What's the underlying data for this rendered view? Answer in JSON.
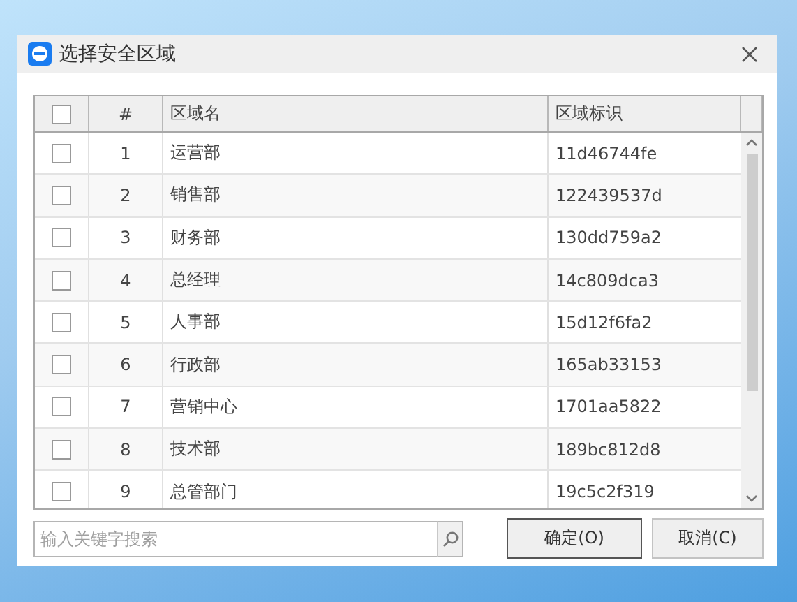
{
  "window": {
    "title": "选择安全区域"
  },
  "table": {
    "select_all": {
      "checked": false
    },
    "columns": [
      "#",
      "区域名",
      "区域标识"
    ],
    "rows": [
      {
        "checked": false,
        "index": "1",
        "name": "运营部",
        "id": "11d46744fe"
      },
      {
        "checked": false,
        "index": "2",
        "name": "销售部",
        "id": "122439537d"
      },
      {
        "checked": false,
        "index": "3",
        "name": "财务部",
        "id": "130dd759a2"
      },
      {
        "checked": false,
        "index": "4",
        "name": "总经理",
        "id": "14c809dca3"
      },
      {
        "checked": false,
        "index": "5",
        "name": "人事部",
        "id": "15d12f6fa2"
      },
      {
        "checked": false,
        "index": "6",
        "name": "行政部",
        "id": "165ab33153"
      },
      {
        "checked": false,
        "index": "7",
        "name": "营销中心",
        "id": "1701aa5822"
      },
      {
        "checked": false,
        "index": "8",
        "name": "技术部",
        "id": "189bc812d8"
      },
      {
        "checked": false,
        "index": "9",
        "name": "总管部门",
        "id": "19c5c2f319"
      }
    ]
  },
  "search": {
    "placeholder": "输入关键字搜索"
  },
  "buttons": [
    {
      "label": "确定(O)",
      "kind": "default"
    },
    {
      "label": "取消(C)",
      "kind": "normal"
    }
  ]
}
